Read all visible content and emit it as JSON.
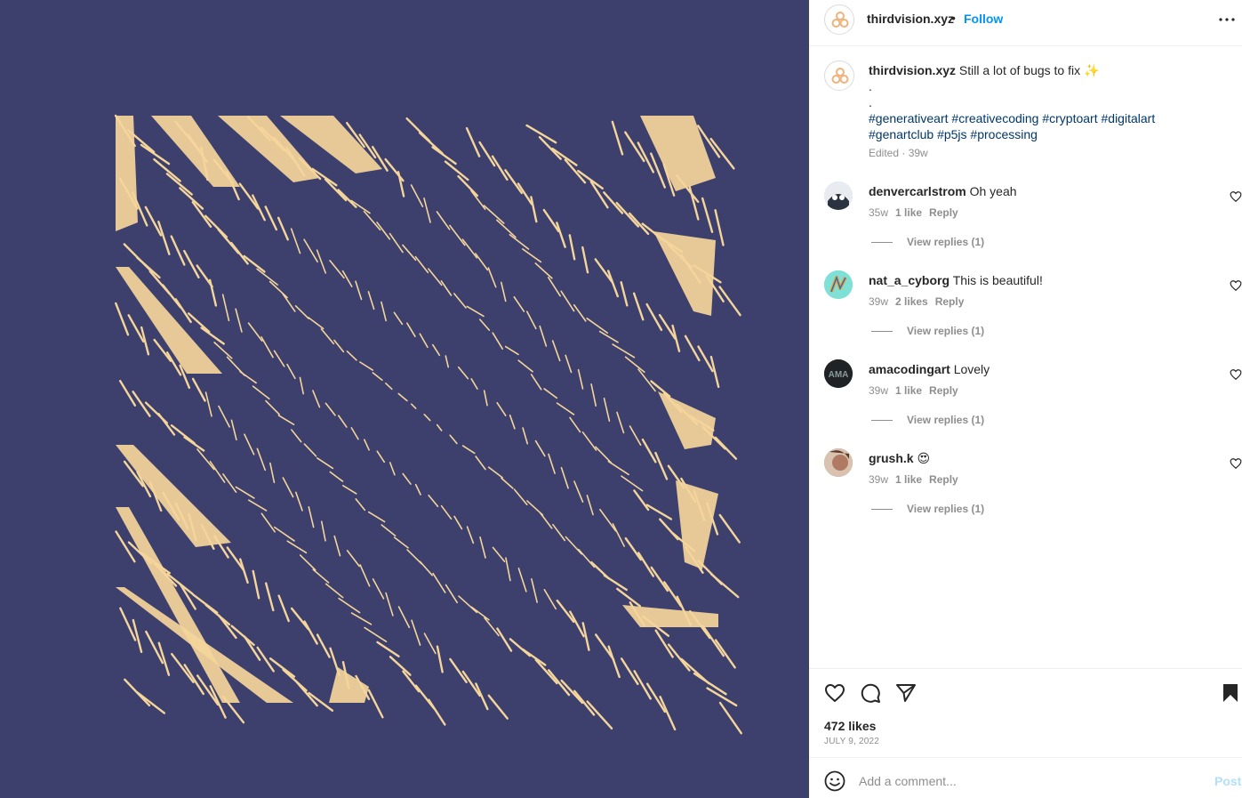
{
  "post": {
    "username": "thirdvision.xyz",
    "separator": "•",
    "follow_label": "Follow",
    "more_icon": "more-options-icon"
  },
  "caption": {
    "username": "thirdvision.xyz",
    "text": "Still a lot of bugs to fix",
    "emoji": "✨",
    "line2": ".",
    "line3": ".",
    "hashtags": [
      "#generativeart",
      "#creativecoding",
      "#cryptoart",
      "#digitalart",
      "#genartclub",
      "#p5js",
      "#processing"
    ],
    "meta": "Edited · 39w"
  },
  "comments": [
    {
      "username": "denvercarlstrom",
      "text": "Oh yeah",
      "age": "35w",
      "likes": "1 like",
      "reply": "Reply",
      "view_replies": "View replies (1)",
      "avatar_color": "#c9cfd8"
    },
    {
      "username": "nat_a_cyborg",
      "text": "This is beautiful!",
      "age": "39w",
      "likes": "2 likes",
      "reply": "Reply",
      "view_replies": "View replies (1)",
      "avatar_color": "#5fd6d0"
    },
    {
      "username": "amacodingart",
      "text": "Lovely",
      "age": "39w",
      "likes": "1 like",
      "reply": "Reply",
      "view_replies": "View replies (1)",
      "avatar_color": "#1f2326",
      "avatar_text": "AMA"
    },
    {
      "username": "grush.k",
      "text": "😍",
      "age": "39w",
      "likes": "1 like",
      "reply": "Reply",
      "view_replies": "View replies (1)",
      "avatar_color": "#b07a62"
    }
  ],
  "actions": {
    "likes_count": "472 likes",
    "date": "JULY 9, 2022"
  },
  "add_comment": {
    "placeholder": "Add a comment...",
    "post_label": "Post"
  },
  "colors": {
    "artwork_background": "#3d3f6d",
    "artwork_stroke": "#f4d59b",
    "link_blue": "#0095f6",
    "hashtag_blue": "#00376b"
  }
}
